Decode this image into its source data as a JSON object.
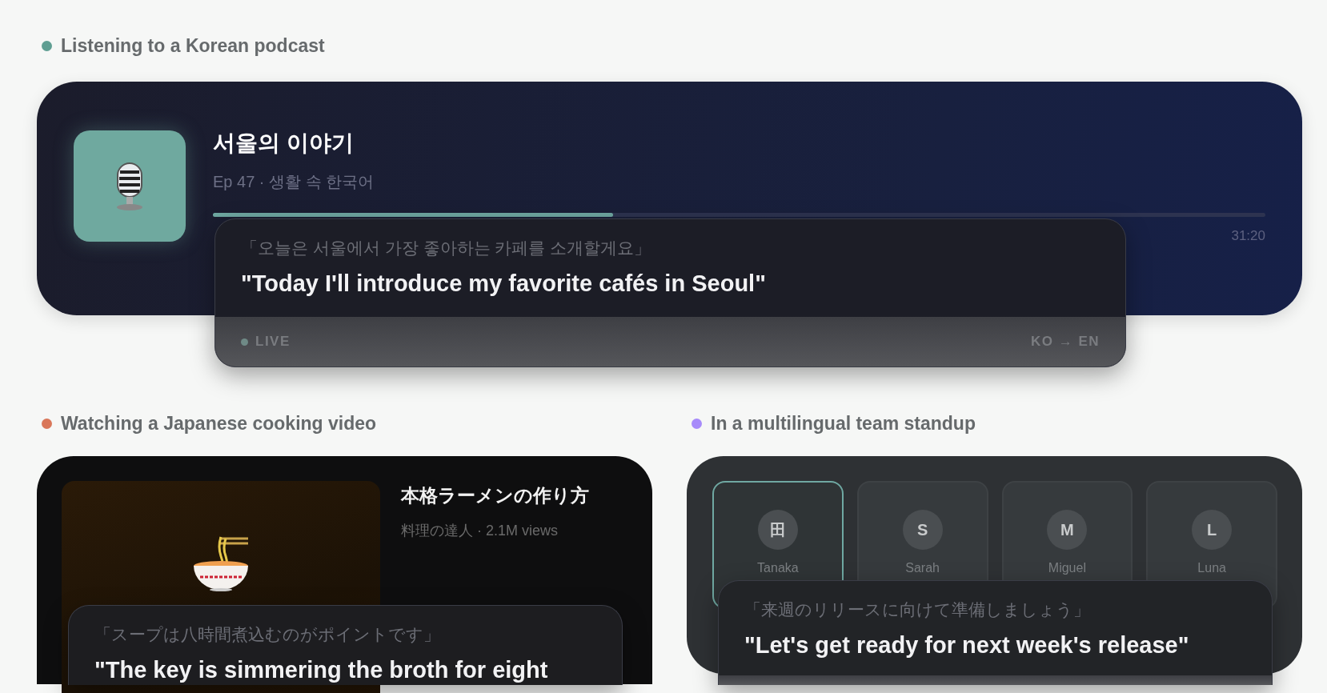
{
  "sections": [
    {
      "kind": "podcast",
      "label": "Listening to a Korean podcast",
      "color": "#5f9e92",
      "title": "서울의 이야기",
      "subtitle": "Ep 47 · 생활 속 한국어",
      "level": 0.38,
      "time": "31:20",
      "caption": {
        "original": "「오늘은 서울에서 가장 좋아하는 카페를 소개할게요」",
        "translation": "\"Today I'll introduce my favorite cafés in Seoul\"",
        "status": "LIVE",
        "direction": "KO → EN"
      }
    },
    {
      "kind": "video",
      "label": "Watching a Japanese cooking video",
      "color": "#d9775a",
      "title": "本格ラーメンの作り方",
      "subtitle": "料理の達人 · 2.1M views",
      "caption": {
        "original": "「スープは八時間煮込むのがポイントです」",
        "translation": "\"The key is simmering the broth for eight"
      }
    },
    {
      "kind": "meeting",
      "label": "In a multilingual team standup",
      "color": "#a78bfa",
      "participants": [
        {
          "initial": "田",
          "name": "Tanaka",
          "selected": true
        },
        {
          "initial": "S",
          "name": "Sarah",
          "selected": false
        },
        {
          "initial": "M",
          "name": "Miguel",
          "selected": false
        },
        {
          "initial": "L",
          "name": "Luna",
          "selected": false
        }
      ],
      "caption": {
        "original": "「来週のリリースに向けて準備しましょう」",
        "translation": "\"Let's get ready for next week's release\""
      }
    }
  ]
}
